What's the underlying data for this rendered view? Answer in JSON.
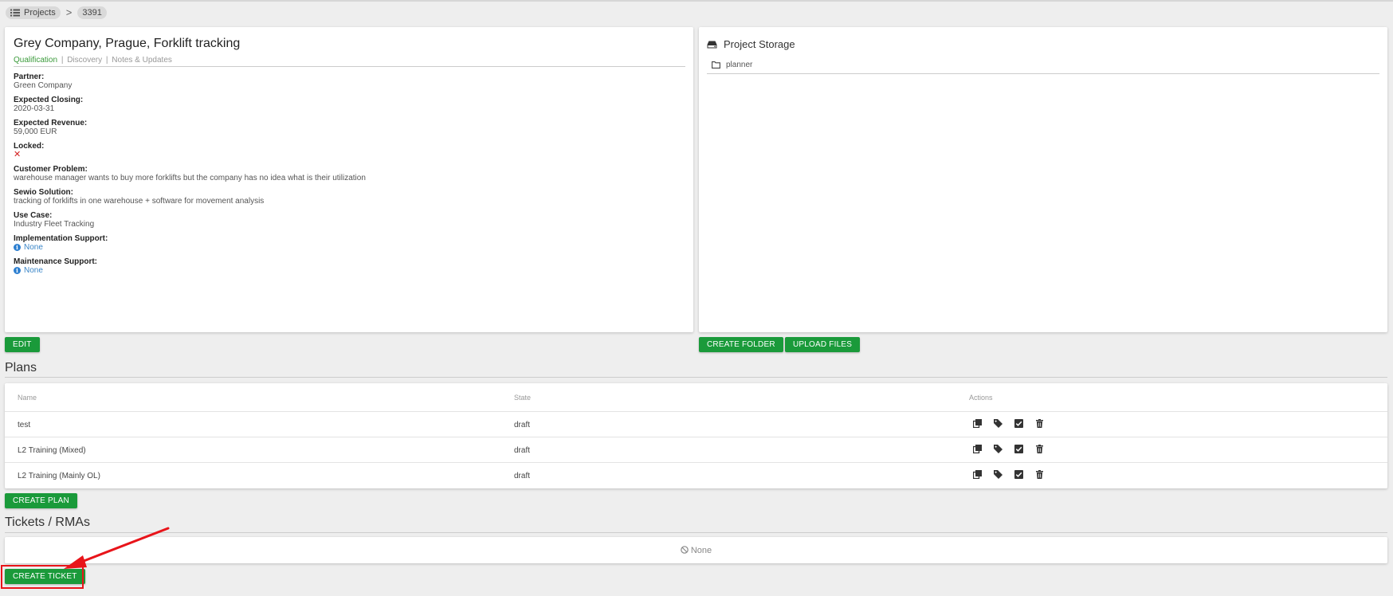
{
  "breadcrumb": {
    "projects": "Projects",
    "separator": ">",
    "id": "3391"
  },
  "project": {
    "title": "Grey Company, Prague, Forklift tracking",
    "tabs": {
      "active": "Qualification",
      "discovery": "Discovery",
      "notes": "Notes & Updates",
      "sep": "|"
    },
    "fields": {
      "partner": {
        "label": "Partner:",
        "value": "Green Company"
      },
      "closing": {
        "label": "Expected Closing:",
        "value": "2020-03-31"
      },
      "revenue": {
        "label": "Expected Revenue:",
        "value": "59,000 EUR"
      },
      "locked": {
        "label": "Locked:",
        "value": "✕"
      },
      "problem": {
        "label": "Customer Problem:",
        "value": "warehouse manager wants to buy more forklifts but the company has no idea what is their utilization"
      },
      "solution": {
        "label": "Sewio Solution:",
        "value": "tracking of forklifts in one warehouse + software for movement analysis"
      },
      "usecase": {
        "label": "Use Case:",
        "value": "Industry Fleet Tracking"
      },
      "impl": {
        "label": "Implementation Support:",
        "value": "None"
      },
      "maint": {
        "label": "Maintenance Support:",
        "value": "None"
      }
    },
    "edit_label": "EDIT"
  },
  "storage": {
    "title": "Project Storage",
    "folder": "planner",
    "create_folder_label": "CREATE FOLDER",
    "upload_files_label": "UPLOAD FILES"
  },
  "plans": {
    "heading": "Plans",
    "columns": {
      "name": "Name",
      "state": "State",
      "actions": "Actions"
    },
    "rows": [
      {
        "name": "test",
        "state": "draft"
      },
      {
        "name": "L2 Training (Mixed)",
        "state": "draft"
      },
      {
        "name": "L2 Training (Mainly OL)",
        "state": "draft"
      }
    ],
    "create_label": "CREATE PLAN"
  },
  "tickets": {
    "heading": "Tickets / RMAs",
    "empty": "None",
    "create_label": "CREATE TICKET"
  },
  "colors": {
    "accent": "#1a9a3a",
    "highlight": "#e8141a",
    "link": "#3a86c8"
  }
}
